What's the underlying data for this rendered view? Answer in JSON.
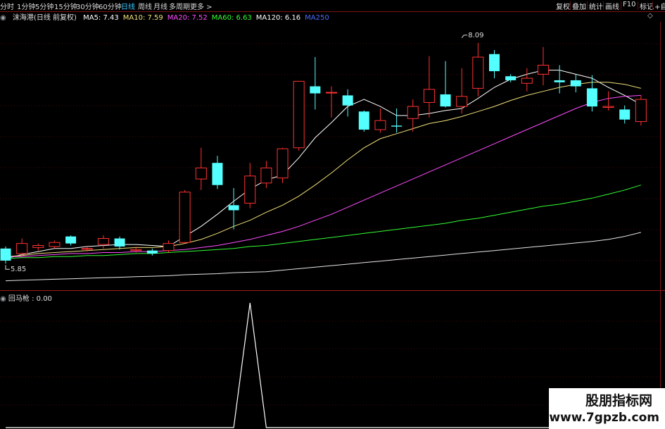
{
  "toolbar": {
    "periods": [
      "分时",
      "1分钟",
      "5分钟",
      "15分钟",
      "30分钟",
      "60分钟",
      "日线",
      "周线",
      "月线",
      "多周期",
      "更多 >"
    ],
    "active_period": "日线",
    "right_buttons": [
      "复权",
      "叠加",
      "统计",
      "画线",
      "F10",
      "标记",
      "+自"
    ]
  },
  "legend": {
    "stock": "沫海港(日线 前复权)",
    "items": [
      {
        "label": "MA5: 7.43",
        "color": "#ffffff"
      },
      {
        "label": "MA10: 7.59",
        "color": "#f0e07a"
      },
      {
        "label": "MA20: 7.52",
        "color": "#ff4dff"
      },
      {
        "label": "MA60: 6.63",
        "color": "#33ff33"
      },
      {
        "label": "MA120: 6.16",
        "color": "#ffffff"
      },
      {
        "label": "MA250",
        "color": "#4a6bff"
      }
    ],
    "diamond": "◇"
  },
  "indicator": {
    "title": "回马枪 : 0.00"
  },
  "watermark": {
    "line1": "股朋指标网",
    "line2": "www.7gpzb.com"
  },
  "chart_data": [
    {
      "type": "candlestick",
      "title": "沫海港(日线 前复权)",
      "ylim": [
        5.6,
        8.25
      ],
      "annotations": [
        {
          "text": "8.09",
          "kind": "high",
          "candle": 28,
          "value": 8.09
        },
        {
          "text": "5.85",
          "kind": "low",
          "candle": 0,
          "value": 5.85
        }
      ],
      "candles": [
        {
          "o": 6.0,
          "h": 6.02,
          "l": 5.85,
          "c": 5.88
        },
        {
          "o": 5.95,
          "h": 6.1,
          "l": 5.93,
          "c": 6.05
        },
        {
          "o": 6.01,
          "h": 6.05,
          "l": 5.98,
          "c": 6.03
        },
        {
          "o": 6.02,
          "h": 6.08,
          "l": 6.0,
          "c": 6.06
        },
        {
          "o": 6.12,
          "h": 6.13,
          "l": 6.03,
          "c": 6.05
        },
        {
          "o": 6.0,
          "h": 6.02,
          "l": 5.97,
          "c": 6.0
        },
        {
          "o": 6.04,
          "h": 6.13,
          "l": 6.0,
          "c": 6.1
        },
        {
          "o": 6.1,
          "h": 6.12,
          "l": 5.99,
          "c": 6.02
        },
        {
          "o": 5.98,
          "h": 6.02,
          "l": 5.96,
          "c": 5.99
        },
        {
          "o": 5.98,
          "h": 6.0,
          "l": 5.93,
          "c": 5.95
        },
        {
          "o": 5.98,
          "h": 6.08,
          "l": 5.96,
          "c": 6.05
        },
        {
          "o": 6.06,
          "h": 6.58,
          "l": 6.05,
          "c": 6.56
        },
        {
          "o": 6.69,
          "h": 7.0,
          "l": 6.58,
          "c": 6.8
        },
        {
          "o": 6.85,
          "h": 6.92,
          "l": 6.59,
          "c": 6.63
        },
        {
          "o": 6.43,
          "h": 6.6,
          "l": 6.19,
          "c": 6.38
        },
        {
          "o": 6.45,
          "h": 6.85,
          "l": 6.4,
          "c": 6.72
        },
        {
          "o": 6.65,
          "h": 6.87,
          "l": 6.6,
          "c": 6.8
        },
        {
          "o": 6.7,
          "h": 7.0,
          "l": 6.65,
          "c": 6.99
        },
        {
          "o": 7.0,
          "h": 7.66,
          "l": 6.97,
          "c": 7.66
        },
        {
          "o": 7.61,
          "h": 7.9,
          "l": 7.38,
          "c": 7.54
        },
        {
          "o": 7.55,
          "h": 7.61,
          "l": 7.3,
          "c": 7.55
        },
        {
          "o": 7.52,
          "h": 7.58,
          "l": 7.31,
          "c": 7.42
        },
        {
          "o": 7.36,
          "h": 7.37,
          "l": 7.16,
          "c": 7.18
        },
        {
          "o": 7.18,
          "h": 7.39,
          "l": 7.15,
          "c": 7.27
        },
        {
          "o": 7.22,
          "h": 7.39,
          "l": 7.15,
          "c": 7.21
        },
        {
          "o": 7.29,
          "h": 7.48,
          "l": 7.16,
          "c": 7.41
        },
        {
          "o": 7.45,
          "h": 7.91,
          "l": 7.3,
          "c": 7.58
        },
        {
          "o": 7.53,
          "h": 7.86,
          "l": 7.4,
          "c": 7.41
        },
        {
          "o": 7.41,
          "h": 7.79,
          "l": 7.34,
          "c": 7.51
        },
        {
          "o": 7.59,
          "h": 8.04,
          "l": 7.51,
          "c": 7.9
        },
        {
          "o": 7.93,
          "h": 7.97,
          "l": 7.69,
          "c": 7.76
        },
        {
          "o": 7.71,
          "h": 7.73,
          "l": 7.65,
          "c": 7.67
        },
        {
          "o": 7.64,
          "h": 7.79,
          "l": 7.56,
          "c": 7.69
        },
        {
          "o": 7.73,
          "h": 8.0,
          "l": 7.62,
          "c": 7.82
        },
        {
          "o": 7.67,
          "h": 7.82,
          "l": 7.54,
          "c": 7.65
        },
        {
          "o": 7.67,
          "h": 7.73,
          "l": 7.55,
          "c": 7.61
        },
        {
          "o": 7.59,
          "h": 7.72,
          "l": 7.36,
          "c": 7.41
        },
        {
          "o": 7.4,
          "h": 7.56,
          "l": 7.37,
          "c": 7.41
        },
        {
          "o": 7.38,
          "h": 7.42,
          "l": 7.24,
          "c": 7.28
        },
        {
          "o": 7.26,
          "h": 7.52,
          "l": 7.22,
          "c": 7.48
        }
      ],
      "ma": [
        {
          "name": "MA5",
          "color": "#ffffff",
          "values": [
            5.9,
            5.94,
            5.97,
            6.0,
            6.0,
            6.02,
            6.03,
            6.04,
            6.04,
            6.03,
            6.02,
            6.12,
            6.22,
            6.34,
            6.47,
            6.59,
            6.68,
            6.73,
            6.9,
            7.1,
            7.25,
            7.41,
            7.48,
            7.41,
            7.32,
            7.32,
            7.34,
            7.37,
            7.39,
            7.49,
            7.6,
            7.68,
            7.73,
            7.77,
            7.77,
            7.73,
            7.69,
            7.6,
            7.52,
            7.43
          ]
        },
        {
          "name": "MA10",
          "color": "#f0e07a",
          "values": [
            5.92,
            5.93,
            5.95,
            5.96,
            5.97,
            5.98,
            5.99,
            6.0,
            6.01,
            6.01,
            6.02,
            6.05,
            6.09,
            6.15,
            6.22,
            6.28,
            6.36,
            6.43,
            6.52,
            6.63,
            6.75,
            6.88,
            7.0,
            7.09,
            7.14,
            7.19,
            7.24,
            7.27,
            7.31,
            7.36,
            7.41,
            7.47,
            7.52,
            7.56,
            7.6,
            7.63,
            7.65,
            7.65,
            7.63,
            7.59
          ]
        },
        {
          "name": "MA20",
          "color": "#ff4dff",
          "values": [
            5.92,
            5.92,
            5.93,
            5.94,
            5.95,
            5.95,
            5.96,
            5.96,
            5.97,
            5.97,
            5.98,
            5.99,
            6.01,
            6.03,
            6.06,
            6.09,
            6.13,
            6.17,
            6.22,
            6.28,
            6.34,
            6.41,
            6.48,
            6.55,
            6.62,
            6.69,
            6.76,
            6.83,
            6.9,
            6.97,
            7.04,
            7.11,
            7.18,
            7.25,
            7.32,
            7.39,
            7.45,
            7.49,
            7.51,
            7.52
          ]
        },
        {
          "name": "MA60",
          "color": "#33ff33",
          "values": [
            5.9,
            5.91,
            5.91,
            5.92,
            5.92,
            5.93,
            5.93,
            5.94,
            5.95,
            5.95,
            5.96,
            5.97,
            5.98,
            5.99,
            6.0,
            6.02,
            6.03,
            6.05,
            6.07,
            6.09,
            6.11,
            6.13,
            6.15,
            6.17,
            6.19,
            6.21,
            6.23,
            6.25,
            6.28,
            6.3,
            6.33,
            6.36,
            6.39,
            6.42,
            6.44,
            6.47,
            6.5,
            6.54,
            6.58,
            6.63
          ]
        },
        {
          "name": "MA120",
          "color": "#e6e6e6",
          "values": [
            5.68,
            5.685,
            5.69,
            5.695,
            5.7,
            5.705,
            5.71,
            5.715,
            5.72,
            5.725,
            5.73,
            5.74,
            5.745,
            5.75,
            5.76,
            5.765,
            5.77,
            5.785,
            5.8,
            5.815,
            5.83,
            5.845,
            5.86,
            5.875,
            5.89,
            5.905,
            5.92,
            5.935,
            5.95,
            5.965,
            5.98,
            5.995,
            6.01,
            6.025,
            6.04,
            6.055,
            6.07,
            6.09,
            6.12,
            6.16
          ]
        }
      ]
    },
    {
      "type": "line",
      "title": "回马枪 : 0.00",
      "ylim": [
        0,
        1
      ],
      "series": [
        {
          "color": "#ffffff",
          "values": [
            0,
            0,
            0,
            0,
            0,
            0,
            0,
            0,
            0,
            0,
            0,
            0,
            0,
            0,
            0,
            1,
            0,
            0,
            0,
            0,
            0,
            0,
            0,
            0,
            0,
            0,
            0,
            0,
            0,
            0,
            0,
            0,
            0,
            0,
            0,
            0,
            0,
            0,
            0,
            0
          ]
        }
      ]
    }
  ]
}
